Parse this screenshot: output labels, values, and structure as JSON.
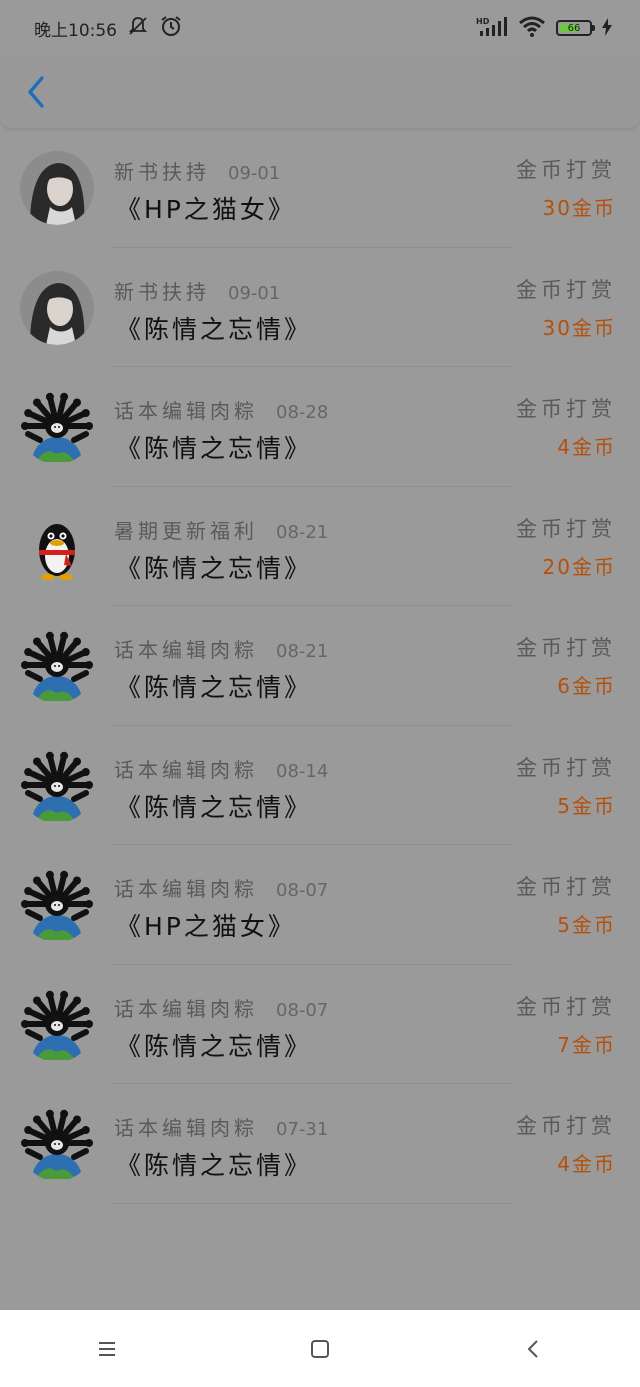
{
  "status": {
    "time": "晚上10:56",
    "battery": "66",
    "battery_level": 66,
    "network": "HD",
    "icons": [
      "mute-icon",
      "alarm-icon",
      "signal-icon",
      "wifi-icon",
      "battery-icon",
      "charging-icon"
    ]
  },
  "header": {
    "back_icon": "chevron-left-icon"
  },
  "colors": {
    "accent": "#1e6fb8",
    "amount": "#b5500a",
    "overlay_bg": "#9a9a9a"
  },
  "rewards": [
    {
      "avatar": "portrait",
      "source": "新书扶持",
      "date": "09-01",
      "book": "《HP之猫女》",
      "label": "金币打赏",
      "amount": "30金币"
    },
    {
      "avatar": "portrait",
      "source": "新书扶持",
      "date": "09-01",
      "book": "《陈情之忘情》",
      "label": "金币打赏",
      "amount": "30金币"
    },
    {
      "avatar": "spider-globe",
      "source": "话本编辑肉粽",
      "date": "08-28",
      "book": "《陈情之忘情》",
      "label": "金币打赏",
      "amount": "4金币"
    },
    {
      "avatar": "penguin",
      "source": "暑期更新福利",
      "date": "08-21",
      "book": "《陈情之忘情》",
      "label": "金币打赏",
      "amount": "20金币"
    },
    {
      "avatar": "spider-globe",
      "source": "话本编辑肉粽",
      "date": "08-21",
      "book": "《陈情之忘情》",
      "label": "金币打赏",
      "amount": "6金币"
    },
    {
      "avatar": "spider-globe",
      "source": "话本编辑肉粽",
      "date": "08-14",
      "book": "《陈情之忘情》",
      "label": "金币打赏",
      "amount": "5金币"
    },
    {
      "avatar": "spider-globe",
      "source": "话本编辑肉粽",
      "date": "08-07",
      "book": "《HP之猫女》",
      "label": "金币打赏",
      "amount": "5金币"
    },
    {
      "avatar": "spider-globe",
      "source": "话本编辑肉粽",
      "date": "08-07",
      "book": "《陈情之忘情》",
      "label": "金币打赏",
      "amount": "7金币"
    },
    {
      "avatar": "spider-globe",
      "source": "话本编辑肉粽",
      "date": "07-31",
      "book": "《陈情之忘情》",
      "label": "金币打赏",
      "amount": "4金币"
    }
  ],
  "nav": {
    "menu_icon": "menu-icon",
    "home_icon": "home-square-icon",
    "back_icon": "back-triangle-icon"
  }
}
